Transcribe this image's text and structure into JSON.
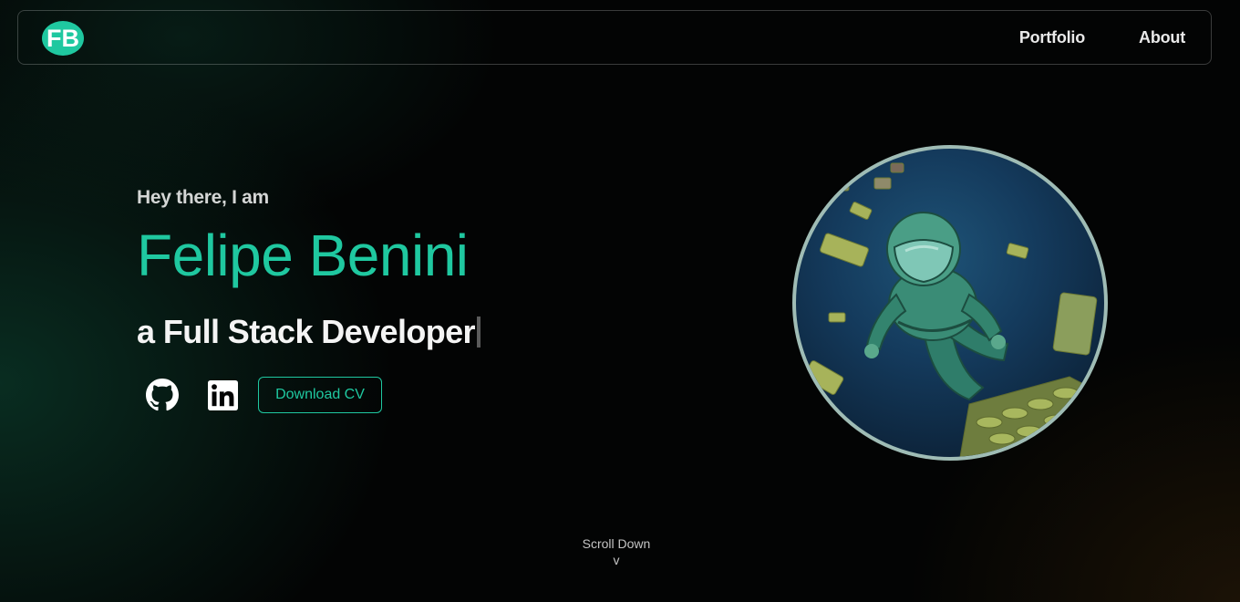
{
  "nav": {
    "logo_text": "FB",
    "links": [
      "Portfolio",
      "About"
    ]
  },
  "hero": {
    "greeting": "Hey there, I am",
    "name": "Felipe Benini",
    "role": "a Full Stack Developer",
    "cv_button": "Download CV"
  },
  "social": {
    "github_icon": "github-icon",
    "linkedin_icon": "linkedin-icon"
  },
  "avatar": {
    "subject": "astronaut-illustration"
  },
  "scroll": {
    "label": "Scroll Down",
    "arrow": "v"
  },
  "colors": {
    "accent": "#1fc8a0",
    "background": "#030404",
    "avatar_border": "#9fbcb5"
  }
}
